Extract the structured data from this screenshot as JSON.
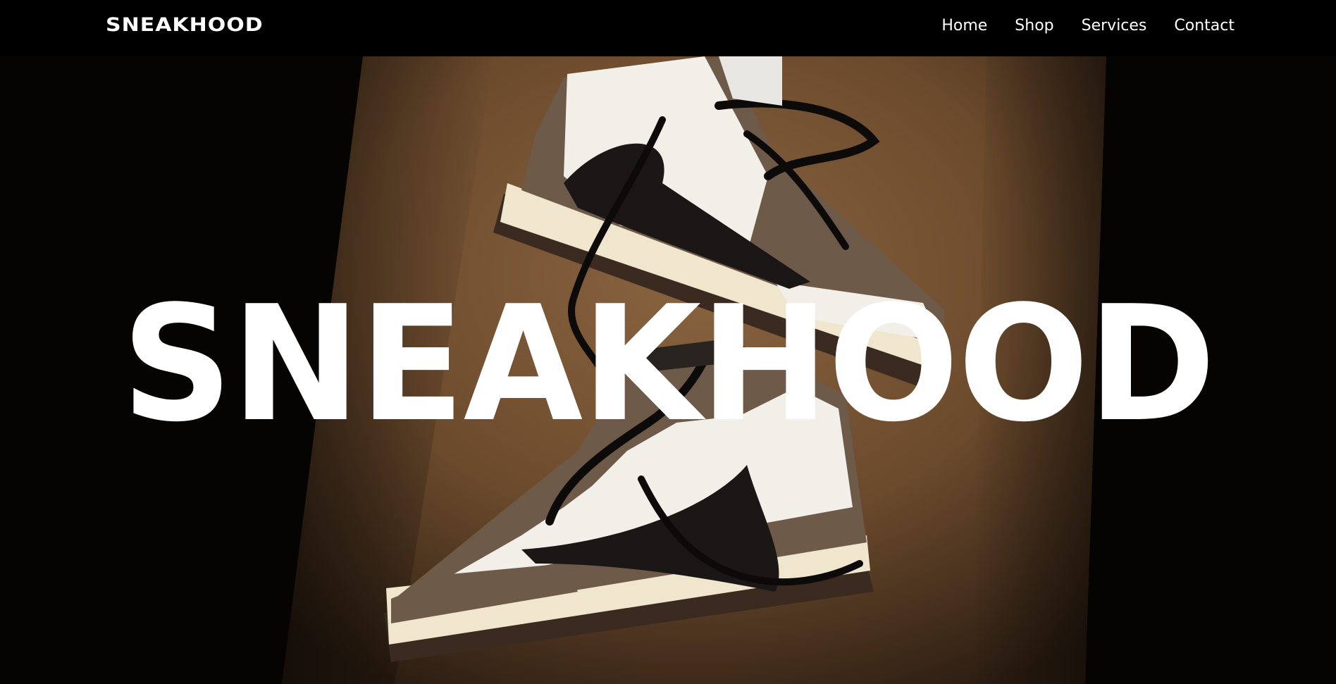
{
  "navbar": {
    "brand": "SNEAKHOOD",
    "links": [
      "Home",
      "Shop",
      "Services",
      "Contact"
    ]
  },
  "hero": {
    "title": "SNEAKHOOD",
    "image": "sneakers-photo"
  },
  "colors": {
    "background": "#000000",
    "backdrop_brown": "#6b4a2c",
    "text": "#ffffff",
    "suede": "#6e5a48",
    "leather": "#f2efe8",
    "swoosh": "#1a1716",
    "midsole": "#efe6cd"
  }
}
